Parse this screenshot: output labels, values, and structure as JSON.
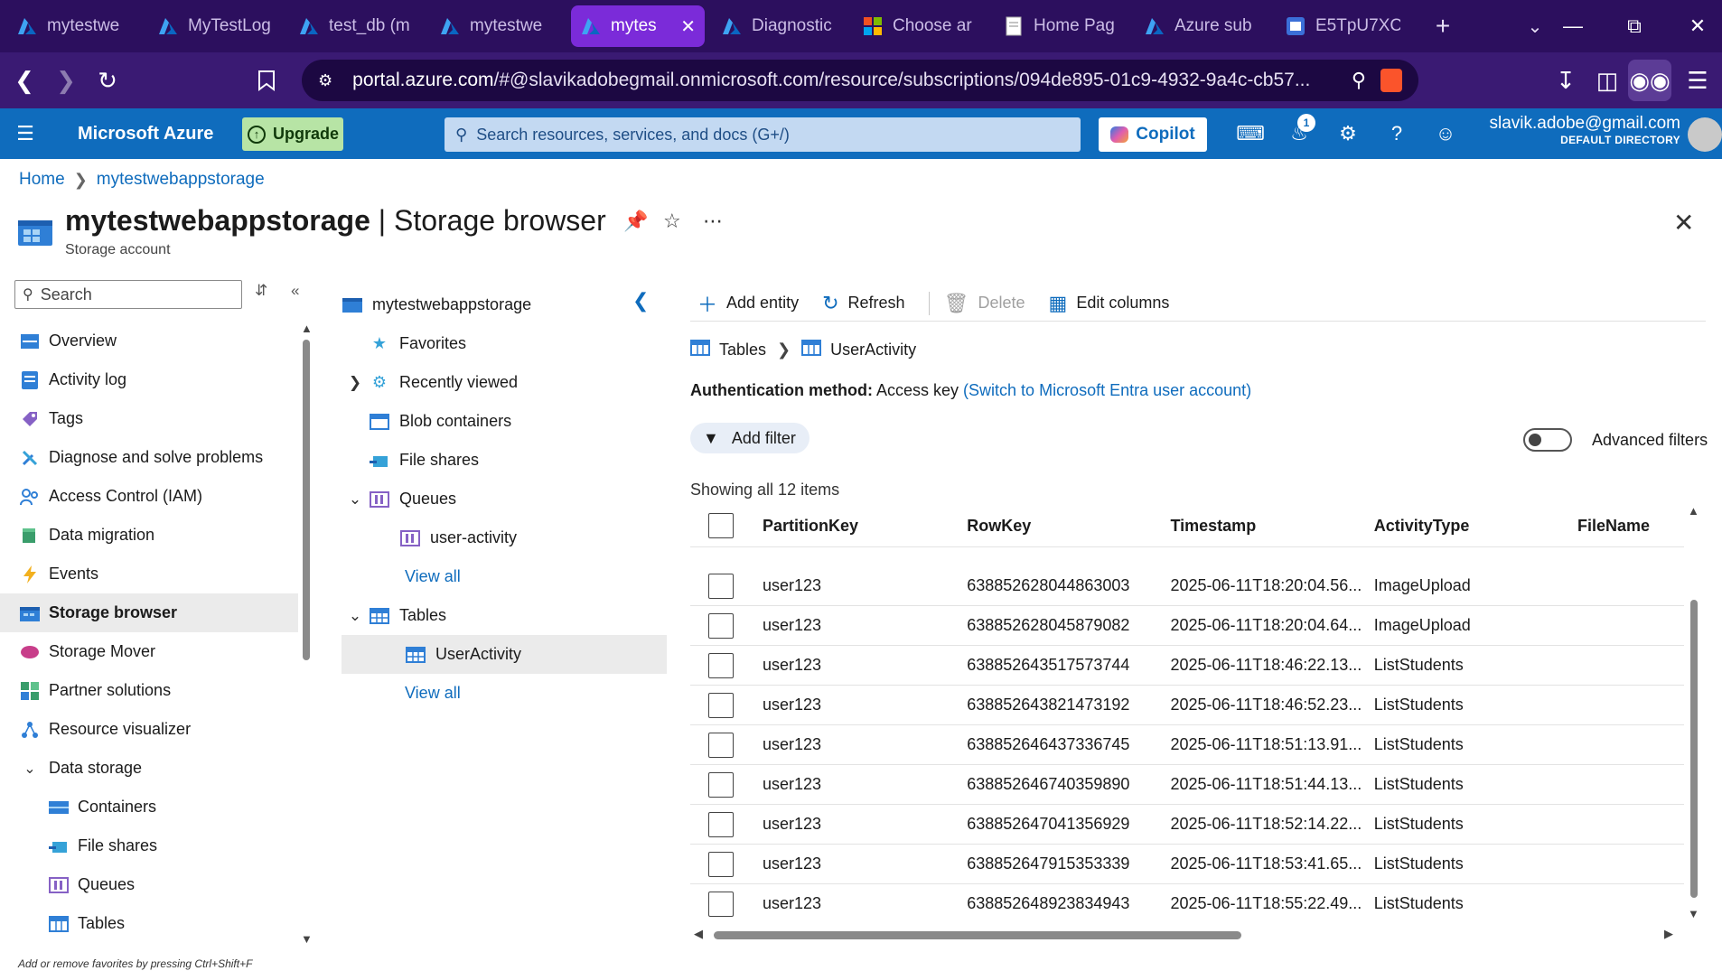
{
  "browser": {
    "tabs": [
      {
        "label": "mytestwe",
        "icon": "azure-icon"
      },
      {
        "label": "MyTestLog",
        "icon": "azure-icon"
      },
      {
        "label": "test_db (m",
        "icon": "azure-icon"
      },
      {
        "label": "mytestwe",
        "icon": "azure-icon"
      },
      {
        "label": "mytes",
        "icon": "azure-icon",
        "active": true
      },
      {
        "label": "Diagnostic",
        "icon": "azure-icon"
      },
      {
        "label": "Choose ar",
        "icon": "microsoft-icon"
      },
      {
        "label": "Home Pag",
        "icon": "page-icon"
      },
      {
        "label": "Azure sub",
        "icon": "azure-icon"
      },
      {
        "label": "E5TpU7XC",
        "icon": "app-icon"
      }
    ],
    "url_host": "portal.azure.com",
    "url_rest": "/#@slavikadobegmail.onmicrosoft.com/resource/subscriptions/094de895-01c9-4932-9a4c-cb57..."
  },
  "azure": {
    "brand": "Microsoft Azure",
    "upgrade_label": "Upgrade",
    "search_placeholder": "Search resources, services, and docs (G+/)",
    "copilot_label": "Copilot",
    "notification_count": "1",
    "account_email": "slavik.adobe@gmail.com",
    "account_directory": "DEFAULT DIRECTORY"
  },
  "breadcrumb": {
    "home": "Home",
    "resource": "mytestwebappstorage"
  },
  "page": {
    "title_resource": "mytestwebappstorage",
    "title_separator": " | ",
    "title_blade": "Storage browser",
    "subtitle": "Storage account"
  },
  "leftnav": {
    "search_placeholder": "Search",
    "items": [
      {
        "label": "Overview",
        "icon": "overview-icon"
      },
      {
        "label": "Activity log",
        "icon": "activity-log-icon"
      },
      {
        "label": "Tags",
        "icon": "tag-icon"
      },
      {
        "label": "Diagnose and solve problems",
        "icon": "wrench-icon"
      },
      {
        "label": "Access Control (IAM)",
        "icon": "people-icon"
      },
      {
        "label": "Data migration",
        "icon": "data-migration-icon"
      },
      {
        "label": "Events",
        "icon": "lightning-icon"
      },
      {
        "label": "Storage browser",
        "icon": "storage-browser-icon",
        "selected": true
      },
      {
        "label": "Storage Mover",
        "icon": "storage-mover-icon"
      },
      {
        "label": "Partner solutions",
        "icon": "partner-icon"
      },
      {
        "label": "Resource visualizer",
        "icon": "visualizer-icon"
      },
      {
        "label": "Data storage",
        "icon": "chevron-down-icon",
        "group": true
      },
      {
        "label": "Containers",
        "icon": "containers-icon",
        "child": true
      },
      {
        "label": "File shares",
        "icon": "file-shares-icon",
        "child": true
      },
      {
        "label": "Queues",
        "icon": "queue-icon",
        "child": true
      },
      {
        "label": "Tables",
        "icon": "table-icon",
        "child": true
      }
    ],
    "footnote": "Add or remove favorites by pressing Ctrl+Shift+F"
  },
  "tree": {
    "root": "mytestwebappstorage",
    "favorites": "Favorites",
    "recently_viewed": "Recently viewed",
    "blob_containers": "Blob containers",
    "file_shares": "File shares",
    "queues": "Queues",
    "queue_item": "user-activity",
    "queues_view_all": "View all",
    "tables": "Tables",
    "table_item": "UserActivity",
    "tables_view_all": "View all"
  },
  "commands": {
    "add_entity": "Add entity",
    "refresh": "Refresh",
    "delete": "Delete",
    "edit_columns": "Edit columns"
  },
  "content": {
    "crumb_tables": "Tables",
    "crumb_table": "UserActivity",
    "auth_label": "Authentication method:",
    "auth_value": "Access key",
    "auth_link": "(Switch to Microsoft Entra user account)",
    "add_filter": "Add filter",
    "advanced_filters": "Advanced filters",
    "advanced_filters_on": false,
    "showing": "Showing all 12 items"
  },
  "table": {
    "columns": [
      "PartitionKey",
      "RowKey",
      "Timestamp",
      "ActivityType",
      "FileName"
    ],
    "rows": [
      [
        "user123",
        "638852628044863003",
        "2025-06-11T18:20:04.56...",
        "ImageUpload",
        ""
      ],
      [
        "user123",
        "638852628045879082",
        "2025-06-11T18:20:04.64...",
        "ImageUpload",
        ""
      ],
      [
        "user123",
        "638852643517573744",
        "2025-06-11T18:46:22.13...",
        "ListStudents",
        ""
      ],
      [
        "user123",
        "638852643821473192",
        "2025-06-11T18:46:52.23...",
        "ListStudents",
        ""
      ],
      [
        "user123",
        "638852646437336745",
        "2025-06-11T18:51:13.91...",
        "ListStudents",
        ""
      ],
      [
        "user123",
        "638852646740359890",
        "2025-06-11T18:51:44.13...",
        "ListStudents",
        ""
      ],
      [
        "user123",
        "638852647041356929",
        "2025-06-11T18:52:14.22...",
        "ListStudents",
        ""
      ],
      [
        "user123",
        "638852647915353339",
        "2025-06-11T18:53:41.65...",
        "ListStudents",
        ""
      ],
      [
        "user123",
        "638852648923834943",
        "2025-06-11T18:55:22.49...",
        "ListStudents",
        ""
      ]
    ]
  },
  "colors": {
    "tabstrip": "#2c0f5e",
    "active_tab": "#7b2bd9",
    "azure_blue": "#0f6cbd",
    "upgrade_green": "#b7e4a5"
  }
}
